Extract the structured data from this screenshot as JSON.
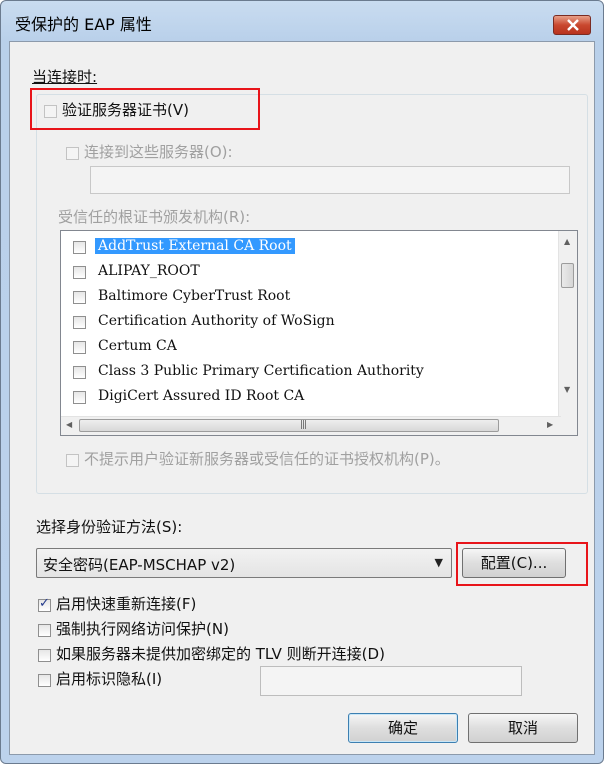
{
  "window": {
    "title": "受保护的 EAP 属性"
  },
  "connect_section": {
    "heading": "当连接时:",
    "verify_cert_label": "验证服务器证书(V)",
    "connect_servers_label": "连接到这些服务器(O):",
    "servers_value": "",
    "trusted_ca_label": "受信任的根证书颁发机构(R):",
    "ca_list": [
      {
        "name": "AddTrust External CA Root",
        "checked": false,
        "selected": true
      },
      {
        "name": "ALIPAY_ROOT",
        "checked": false,
        "selected": false
      },
      {
        "name": "Baltimore CyberTrust Root",
        "checked": false,
        "selected": false
      },
      {
        "name": "Certification Authority of WoSign",
        "checked": false,
        "selected": false
      },
      {
        "name": "Certum CA",
        "checked": false,
        "selected": false
      },
      {
        "name": "Class 3 Public Primary Certification Authority",
        "checked": false,
        "selected": false
      },
      {
        "name": "DigiCert Assured ID Root CA",
        "checked": false,
        "selected": false
      }
    ],
    "no_prompt_label": "不提示用户验证新服务器或受信任的证书授权机构(P)。"
  },
  "auth_section": {
    "method_label": "选择身份验证方法(S):",
    "method_value": "安全密码(EAP-MSCHAP v2)",
    "configure_button": "配置(C)...",
    "options": [
      {
        "label": "启用快速重新连接(F)",
        "checked": true
      },
      {
        "label": "强制执行网络访问保护(N)",
        "checked": false
      },
      {
        "label": "如果服务器未提供加密绑定的 TLV 则断开连接(D)",
        "checked": false
      },
      {
        "label": "启用标识隐私(I)",
        "checked": false
      }
    ],
    "identity_privacy_value": ""
  },
  "footer": {
    "ok_button": "确定",
    "cancel_button": "取消"
  },
  "colors": {
    "highlight": "#e8141a",
    "selection": "#3399ff"
  }
}
